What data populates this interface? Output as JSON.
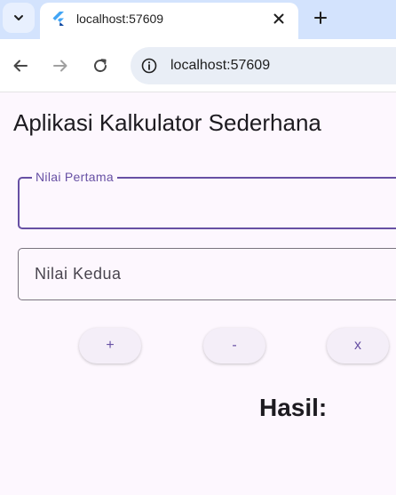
{
  "browser": {
    "tab": {
      "title": "localhost:57609",
      "favicon": "flutter-icon"
    },
    "omnibox": {
      "url": "localhost:57609"
    },
    "icons": {
      "tab_search": "chevron-down-icon",
      "close": "close-icon",
      "new_tab": "plus-icon",
      "back": "back-arrow-icon",
      "forward": "forward-arrow-icon",
      "reload": "reload-icon",
      "site_info": "info-icon"
    }
  },
  "app": {
    "title": "Aplikasi Kalkulator Sederhana",
    "first_field": {
      "label": "Nilai Pertama",
      "value": ""
    },
    "second_field": {
      "placeholder": "Nilai Kedua",
      "value": ""
    },
    "buttons": [
      {
        "label": "+"
      },
      {
        "label": "-"
      },
      {
        "label": "x"
      }
    ],
    "result_label": "Hasil:"
  },
  "colors": {
    "accent": "#6750a4",
    "background": "#fdf7fe",
    "tabstrip": "#d3e3fd",
    "button_bg": "#f4eef8"
  }
}
